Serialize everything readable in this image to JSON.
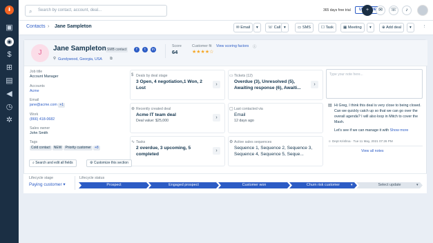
{
  "topbar": {
    "search_placeholder": "Search by contact, account, deal...",
    "trial_text": "365 days free trial",
    "upgrade_label": "UPGRADE"
  },
  "subbar": {
    "breadcrumb_root": "Contacts",
    "breadcrumb_current": "Jane Sampleton",
    "buttons": {
      "email": "Email",
      "call": "Call",
      "sms": "SMS",
      "task": "Task",
      "meeting": "Meeting",
      "add_deal": "Add deal"
    }
  },
  "contact": {
    "initial": "J",
    "name": "Jane Sampleton",
    "badge": "SMB contact",
    "location": "Gundywood, Georgia, USA",
    "score_label": "Score",
    "score_value": "64",
    "fit_label": "Customer fit",
    "stars_rating": 4,
    "stars_text": "★★★★☆",
    "scoring_link": "View scoring factors"
  },
  "fields": {
    "job_title_label": "Job title",
    "job_title": "Account Manager",
    "accounts_label": "Accounts",
    "account": "Acme",
    "email_label": "Email",
    "email": "jane@acme.com",
    "email_more": "+1",
    "work_label": "Work",
    "work": "(866) 418-0682",
    "owner_label": "Sales owner",
    "owner": "John Smith",
    "tags_label": "Tags",
    "tags": [
      "Cold contact",
      "NEW",
      "Priority customer"
    ],
    "tags_more": "+8"
  },
  "tiles": {
    "deals_title": "Deals by deal stage",
    "deals_value": "3 Open, 4 negotiation,1 Won, 2 Lost",
    "tickets_title": "Tickets (12)",
    "tickets_value": "Overdue (3), Unresolved (5), Awaiting response (6), Awaiti...",
    "recent_title": "Recently created deal",
    "recent_value": "Acme IT team deal",
    "recent_sub": "Deal value: $25,000",
    "contacted_title": "Last contacted via",
    "contacted_value": "Email",
    "contacted_sub": "12 days ago",
    "tasks_title": "Tasks",
    "tasks_value": "2 overdue, 3 upcoming, 5 completed",
    "seq_title": "Active sales sequences",
    "seq_value": "Sequence 1, Sequence 2, Sequence 3, Sequence 4, Sequence 5, Seque..."
  },
  "notes": {
    "placeholder": "Type your note here...",
    "text": "Hi Greg, I think this deal is very close to being closed. Can we quickly catch up so that we can go over the overall agenda? I will also loop in Mitch to cover the Mash.",
    "follow": "Let's see if we can manage it with",
    "show_more": "Show more",
    "author": "Dept Krishna",
    "time": "Tue 11 May, 2021 07:26 PM",
    "view_all": "View all notes"
  },
  "actions": {
    "search_fields": "Search and edit all fields",
    "customize": "Customize this section"
  },
  "lifecycle": {
    "stage_label": "Lifecycle stage",
    "stage_value": "Paying customer",
    "status_label": "Lifecycle status",
    "statuses": [
      "Prospect",
      "Engaged prospect",
      "Customer won",
      "Churn risk customer",
      "Select update"
    ]
  },
  "colors": {
    "accent": "#2c5cc5",
    "rail": "#1b2f44",
    "avatar_bg": "#fbdde8",
    "star": "#f5a623"
  }
}
